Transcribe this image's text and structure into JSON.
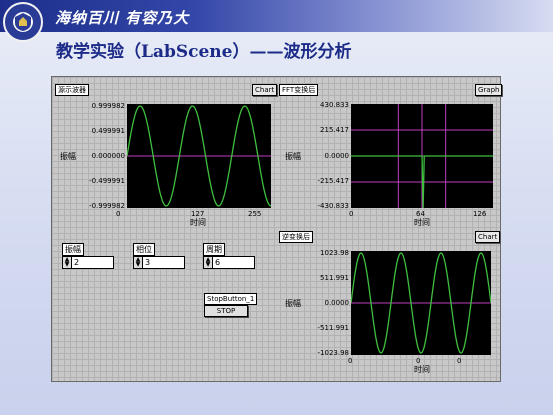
{
  "slide": {
    "motto": "海纳百川 有容乃大",
    "title": "教学实验（LabScene）——波形分析"
  },
  "plots": {
    "source": {
      "label": "源示波器",
      "button": "Chart",
      "ylabel": "振幅",
      "xlabel": "时间",
      "yticks": [
        "0.999982",
        "0.499991",
        "0.000000",
        "-0.499991",
        "-0.999982"
      ],
      "xticks": [
        "0",
        "127",
        "255"
      ]
    },
    "fft": {
      "label": "FFT变换后",
      "button": "Graph",
      "ylabel": "振幅",
      "xlabel": "时间",
      "yticks": [
        "430.833",
        "215.417",
        "0.0000",
        "-215.417",
        "-430.833"
      ],
      "xticks": [
        "0",
        "64",
        "126"
      ]
    },
    "inverse": {
      "label": "逆变换后",
      "button": "Chart",
      "ylabel": "振幅",
      "xlabel": "时间",
      "yticks": [
        "1023.98",
        "511.991",
        "0.0000",
        "-511.991",
        "-1023.98"
      ],
      "xticks": [
        "0",
        "0",
        "0"
      ]
    }
  },
  "controls": {
    "amplitude": {
      "label": "振幅",
      "value": "2"
    },
    "phase": {
      "label": "相位",
      "value": "3"
    },
    "period": {
      "label": "周期",
      "value": "6"
    },
    "stop": {
      "label": "StopButton_1",
      "button": "STOP"
    }
  },
  "chart_data": [
    {
      "type": "line",
      "title": "源示波器",
      "xlabel": "时间",
      "ylabel": "振幅",
      "xlim": [
        0,
        255
      ],
      "ylim": [
        -0.999982,
        0.999982
      ],
      "series": [
        {
          "color": "#3fbf3f",
          "function": "sine",
          "amplitude": 0.999982,
          "cycles": 2.75
        }
      ]
    },
    {
      "type": "line",
      "title": "FFT变换后",
      "xlabel": "时间",
      "ylabel": "振幅",
      "xlim": [
        0,
        126
      ],
      "ylim": [
        -430.833,
        430.833
      ],
      "series": [
        {
          "color": "#3fbf3f",
          "points": [
            [
              0,
              0
            ],
            [
              63,
              0
            ],
            [
              64,
              -430.833
            ],
            [
              65,
              0
            ],
            [
              126,
              0
            ]
          ]
        }
      ]
    },
    {
      "type": "line",
      "title": "逆变换后",
      "xlabel": "时间",
      "ylabel": "振幅",
      "ylim": [
        -1023.98,
        1023.98
      ],
      "series": [
        {
          "color": "#3fbf3f",
          "function": "sine",
          "amplitude": 1023.98,
          "cycles": 3.5
        }
      ]
    }
  ],
  "colors": {
    "trace": "#3fbf3f",
    "gridline": "#c040c0",
    "plot_bg": "#000000"
  }
}
